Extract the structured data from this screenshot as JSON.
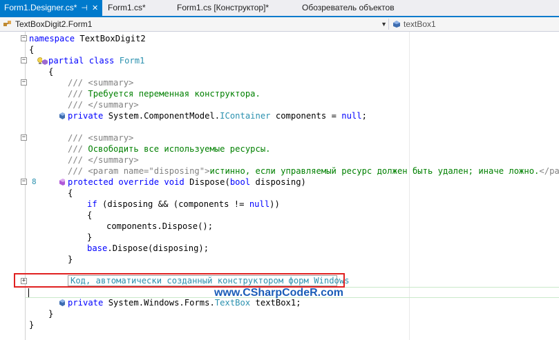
{
  "tabs": [
    {
      "label": "Form1.Designer.cs*",
      "active": true
    },
    {
      "label": "Form1.cs*",
      "active": false
    },
    {
      "label": "Form1.cs [Конструктор]*",
      "active": false
    },
    {
      "label": "Обозреватель объектов",
      "active": false
    }
  ],
  "tab_icons": {
    "pin": "pin-icon",
    "close": "close-icon"
  },
  "nav": {
    "class_combo": "TextBoxDigit2.Form1",
    "member_combo": "textBox1"
  },
  "code": {
    "l1_kw": "namespace",
    "l1_name": " TextBoxDigit2",
    "l2": "{",
    "l3_kw": "partial class",
    "l3_type": " Form1",
    "l4": "{",
    "l5": "/// <summary>",
    "l6_slashes": "/// ",
    "l6_text": "Требуется переменная конструктора.",
    "l7": "/// </summary>",
    "l8_kw": "private",
    "l8_a": " System.ComponentModel.",
    "l8_type": "IContainer",
    "l8_b": " components = ",
    "l8_kw2": "null",
    "l8_c": ";",
    "l9": "/// <summary>",
    "l10_slashes": "/// ",
    "l10_text": "Освободить все используемые ресурсы.",
    "l11": "/// </summary>",
    "l12_a": "/// <param name=\"disposing\">",
    "l12_text": "истинно, если управляемый ресурс должен быть удален; иначе ложно.",
    "l12_b": "</param>",
    "l13_num": "8",
    "l13_kw": "protected override void",
    "l13_a": " Dispose(",
    "l13_kw2": "bool",
    "l13_b": " disposing)",
    "l14": "{",
    "l15_kw": "if",
    "l15_a": " (disposing && (components != ",
    "l15_kw2": "null",
    "l15_b": "))",
    "l16": "{",
    "l17": "components.Dispose();",
    "l18": "}",
    "l19_kw": "base",
    "l19_a": ".Dispose(disposing);",
    "l20": "}",
    "region": "Код, автоматически созданный конструктором форм Windows",
    "l22_kw": "private",
    "l22_a": " System.Windows.Forms.",
    "l22_type": "TextBox",
    "l22_b": " textBox1;",
    "l23": "}",
    "l24": "}"
  },
  "watermark": "www.CSharpCodeR.com",
  "colors": {
    "accent": "#007acc",
    "keyword": "#0000ff",
    "type": "#2b91af",
    "comment": "#008000",
    "highlight": "#e02020"
  }
}
